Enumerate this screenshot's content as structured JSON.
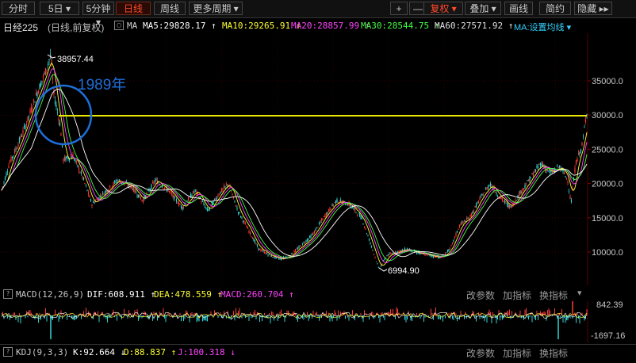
{
  "toolbar": {
    "items": [
      {
        "label": "分时"
      },
      {
        "label": "5日 ▾"
      },
      {
        "label": "5分钟 ▾"
      },
      {
        "label": "日线"
      },
      {
        "label": "周线"
      },
      {
        "label": "更多周期 ▾"
      }
    ],
    "right": [
      {
        "label": "+"
      },
      {
        "label": "—"
      },
      {
        "label": "复权 ▾"
      },
      {
        "label": "叠加 ▾"
      },
      {
        "label": "画线"
      },
      {
        "label": "简约"
      },
      {
        "label": "隐藏 ▸▸"
      }
    ]
  },
  "main_header": {
    "name": "日经225",
    "mode": "(日线,前复权)",
    "gear": "▢",
    "ma_label": "MA",
    "ma5": "MA5:29828.17 ↑",
    "ma10": "MA10:29265.91 ↑",
    "ma20": "MA20:28857.99 ↑",
    "ma30": "MA30:28544.75 ↑",
    "ma60": "MA60:27571.92 ↑",
    "ma_setting": "MA:设置均线 ▾"
  },
  "annotations": {
    "high": "38957.44",
    "low": "6994.90",
    "year_label": "1989年"
  },
  "price_axis": [
    "35000.0",
    "30000.0",
    "25000.0",
    "20000.0",
    "15000.0",
    "10000.0"
  ],
  "macd": {
    "name": "MACD(12,26,9)",
    "dif": "DIF:608.911 ↑",
    "dea": "DEA:478.559 ↑",
    "macd": "MACD:260.704 ↑",
    "axis_top": "842.39",
    "axis_bottom": "-1697.16"
  },
  "kdj": {
    "name": "KDJ(9,3,3)",
    "k": "K:92.664 ↓",
    "d": "D:88.837 ↑",
    "j": "J:100.318 ↓"
  },
  "panel_buttons": {
    "params": "改参数",
    "add": "加指标",
    "swap": "换指标"
  },
  "colors": {
    "background": "#000000",
    "price_line": "#e8e800",
    "up": "#ff3a3a",
    "down": "#35d4d4",
    "ma5": "#ffffff",
    "ma10": "#ffff33",
    "ma20": "#ff44ff",
    "ma30": "#44ff44",
    "ma60": "#ffffff",
    "annotation": "#1e6fd9"
  }
}
